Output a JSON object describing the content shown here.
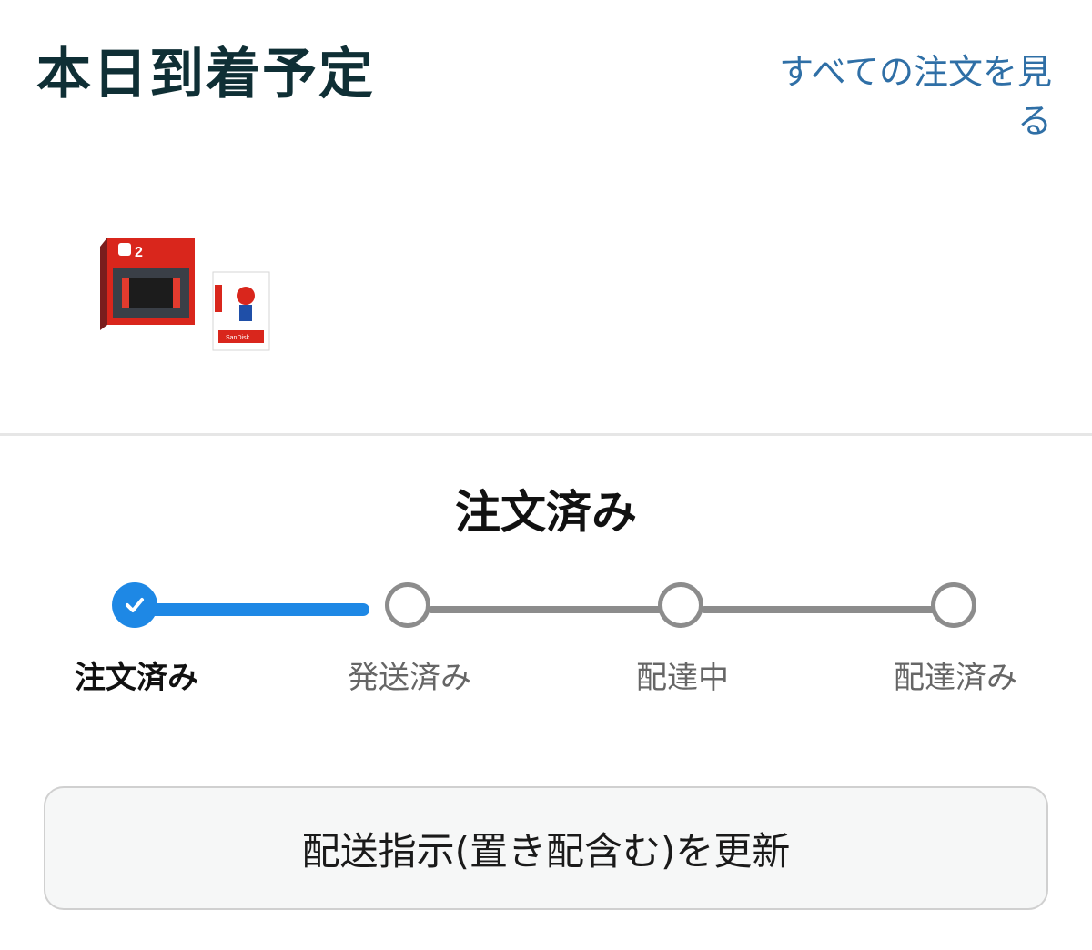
{
  "header": {
    "title": "本日到着予定",
    "see_all_orders": "すべての注文を見る"
  },
  "item": {
    "thumbnail_icon": "product-thumbnail",
    "switch_box_text": "2",
    "sd_card_brand": "SanDisk"
  },
  "status": {
    "current_label": "注文済み",
    "steps": [
      {
        "label": "注文済み",
        "state": "done"
      },
      {
        "label": "発送済み",
        "state": "todo"
      },
      {
        "label": "配達中",
        "state": "todo"
      },
      {
        "label": "配達済み",
        "state": "todo"
      }
    ],
    "progress_fraction": 0.33
  },
  "actions": {
    "update_delivery_label": "配送指示(置き配含む)を更新"
  },
  "colors": {
    "title": "#0f2f35",
    "link": "#2f6fa6",
    "progress": "#1e88e5",
    "inactive": "#8c8c8c"
  }
}
